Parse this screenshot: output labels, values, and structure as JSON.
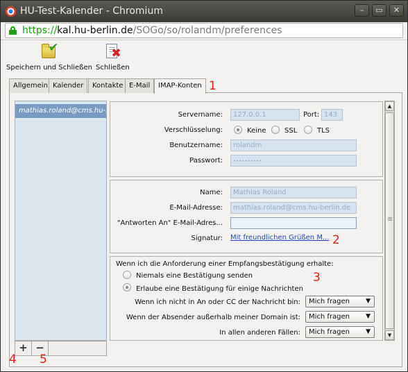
{
  "window": {
    "title": "HU-Test-Kalender - Chromium",
    "controls": [
      "–",
      "▭",
      "✕"
    ]
  },
  "urlbar": {
    "scheme": "https://",
    "host": "kal.hu-berlin.de",
    "path": "/SOGo/so/rolandm/preferences"
  },
  "toolbar": {
    "save_close_label": "Speichern und Schließen",
    "close_label": "Schließen"
  },
  "tabs": [
    "Allgemein",
    "Kalender",
    "Kontakte",
    "E-Mail",
    "IMAP-Konten"
  ],
  "active_tab": "IMAP-Konten",
  "accounts": [
    "mathias.roland@cms.hu-berlin.de"
  ],
  "account_buttons": {
    "add": "+",
    "remove": "−"
  },
  "server": {
    "servername_label": "Servername:",
    "servername_value": "127.0.0.1",
    "port_label": "Port:",
    "port_value": "143",
    "encryption_label": "Verschlüsselung:",
    "encryption_options": [
      "Keine",
      "SSL",
      "TLS"
    ],
    "encryption_selected": "Keine",
    "username_label": "Benutzername:",
    "username_value": "rolandm",
    "password_label": "Passwort:",
    "password_value": "••••••••••"
  },
  "identity": {
    "name_label": "Name:",
    "name_value": "Mathias Roland",
    "email_label": "E-Mail-Adresse:",
    "email_value": "mathias.roland@cms.hu-berlin.de",
    "replyto_label": "\"Antworten An\" E-Mail-Adres...",
    "replyto_value": "",
    "signature_label": "Signatur:",
    "signature_link": "Mit freundlichen Grüßen M..."
  },
  "receipts": {
    "heading": "Wenn ich die Anforderung einer Empfangsbestätigung erhalte:",
    "option_never": "Niemals eine Bestätigung senden",
    "option_allow": "Erlaube eine Bestätigung für einige Nachrichten",
    "selected": "Erlaube eine Bestätigung für einige Nachrichten",
    "rule1_label": "Wenn ich nicht in An oder CC der Nachricht bin:",
    "rule1_value": "Mich fragen",
    "rule2_label": "Wenn der Absender außerhalb meiner Domain ist:",
    "rule2_value": "Mich fragen",
    "rule3_label": "In allen anderen Fällen:",
    "rule3_value": "Mich fragen"
  },
  "annotations": [
    "1",
    "2",
    "3",
    "4",
    "5"
  ],
  "colors": {
    "annotation": "#e0201a",
    "link": "#2447c5",
    "selected_account": "#7c9bc0"
  }
}
